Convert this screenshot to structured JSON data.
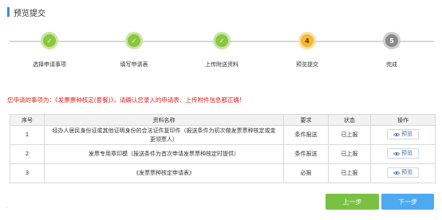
{
  "page": {
    "title": "预览提交"
  },
  "steps": [
    {
      "label": "选择申请事项",
      "status": "done",
      "mark": "✓"
    },
    {
      "label": "填写申请表",
      "status": "done",
      "mark": "✓"
    },
    {
      "label": "上传附送资料",
      "status": "done",
      "mark": "✓"
    },
    {
      "label": "预览提交",
      "status": "current",
      "mark": "4"
    },
    {
      "label": "完成",
      "status": "todo",
      "mark": "5"
    }
  ],
  "notice": "您申请的事项为：《发票票种核定(套餐)》，请确认您录入的申请表、上传附件信息都正确!",
  "table": {
    "headers": [
      "序号",
      "资料名称",
      "要求",
      "状态",
      "操作"
    ],
    "rows": [
      {
        "no": "1",
        "name": "经办人居民身份证或其他证明身份的合法证件复印件（报送条件为初次做发票票种核定或变更领票人）",
        "requirement": "条件报送",
        "status": "已上报",
        "action": "预览"
      },
      {
        "no": "2",
        "name": "发票专用章印模（报送条件为首次申请发票票种核定时提供）",
        "requirement": "条件报送",
        "status": "已上报",
        "action": "预览"
      },
      {
        "no": "3",
        "name": "《发票票种核定申请表》",
        "requirement": "必报",
        "status": "已上报",
        "action": "预览"
      }
    ]
  },
  "footer": {
    "prev_label": "上一步",
    "next_label": "下一步",
    "dot": "."
  },
  "colors": {
    "accent": "#3d8ce0",
    "done": "#8cc63e",
    "current": "#f6b731",
    "todo": "#8a8a8a",
    "warning": "#e0231f",
    "prev_button": "#7ac143",
    "next_button": "#4da9f0"
  },
  "icons": {
    "step_done": "check-icon",
    "preview": "eye-icon"
  }
}
